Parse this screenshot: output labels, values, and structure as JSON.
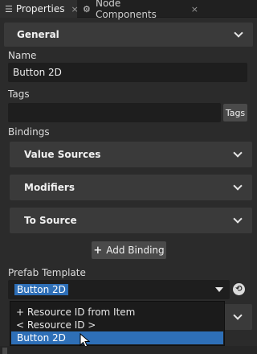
{
  "tabs": [
    {
      "label": "Properties",
      "icon": "list-icon",
      "close": "×"
    },
    {
      "label": "Node Components",
      "icon": "components-icon",
      "close": "×"
    }
  ],
  "sections": {
    "general": {
      "label": "General"
    }
  },
  "fields": {
    "name": {
      "label": "Name",
      "value": "Button 2D"
    },
    "tags": {
      "label": "Tags",
      "value": "",
      "button_label": "Tags"
    },
    "bindings": {
      "label": "Bindings"
    }
  },
  "binding_sections": [
    {
      "label": "Value Sources"
    },
    {
      "label": "Modifiers"
    },
    {
      "label": "To Source"
    }
  ],
  "add_binding": {
    "label": "Add Binding",
    "icon": "plus-icon"
  },
  "prefab": {
    "label": "Prefab Template",
    "selected": "Button 2D",
    "options": [
      "+ Resource ID from Item",
      "< Resource ID >",
      "Button 2D"
    ],
    "highlighted_option": "Button 2D"
  },
  "colors": {
    "panel": "#2b2b2b",
    "header": "#3a3a3a",
    "field": "#1e1e1e",
    "selection": "#2e6fb7"
  }
}
